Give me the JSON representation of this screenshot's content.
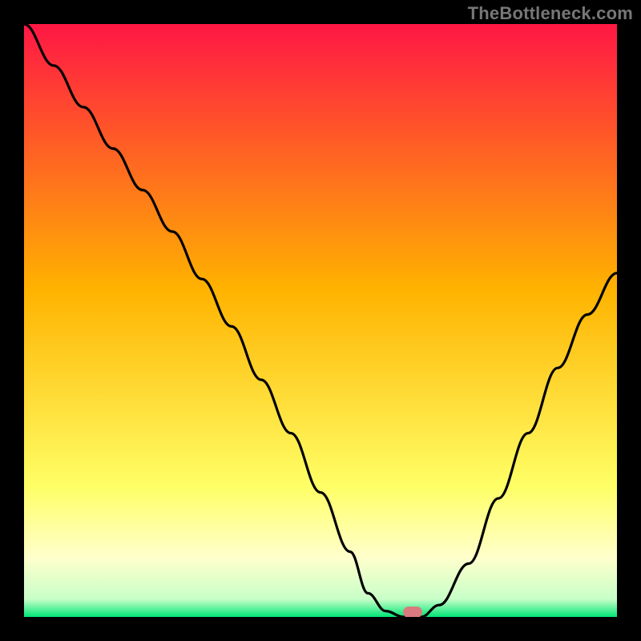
{
  "watermark": "TheBottleneck.com",
  "colors": {
    "red_top": "#ff1744",
    "orange_mid": "#ffb300",
    "yellow_low": "#ffff66",
    "pale_yellow": "#ffffcc",
    "green_bottom": "#00e676",
    "curve": "#000000",
    "marker": "#d97a7f",
    "frame": "#000000"
  },
  "chart_data": {
    "type": "line",
    "title": "",
    "xlabel": "",
    "ylabel": "",
    "xlim": [
      0,
      100
    ],
    "ylim": [
      0,
      100
    ],
    "x": [
      0,
      5,
      10,
      15,
      20,
      25,
      30,
      35,
      40,
      45,
      50,
      55,
      58,
      61,
      64,
      67,
      70,
      75,
      80,
      85,
      90,
      95,
      100
    ],
    "values": [
      100,
      93,
      86,
      79,
      72,
      65,
      57,
      49,
      40,
      31,
      21,
      11,
      4,
      1,
      0,
      0,
      2,
      9,
      20,
      31,
      42,
      51,
      58
    ],
    "marker": {
      "x": 65.5,
      "y": 0.8
    },
    "background_gradient_stops": [
      {
        "offset": 0.0,
        "color": "#ff1744"
      },
      {
        "offset": 0.45,
        "color": "#ffb300"
      },
      {
        "offset": 0.78,
        "color": "#ffff66"
      },
      {
        "offset": 0.9,
        "color": "#ffffcc"
      },
      {
        "offset": 0.97,
        "color": "#c8ffc8"
      },
      {
        "offset": 1.0,
        "color": "#00e676"
      }
    ]
  }
}
